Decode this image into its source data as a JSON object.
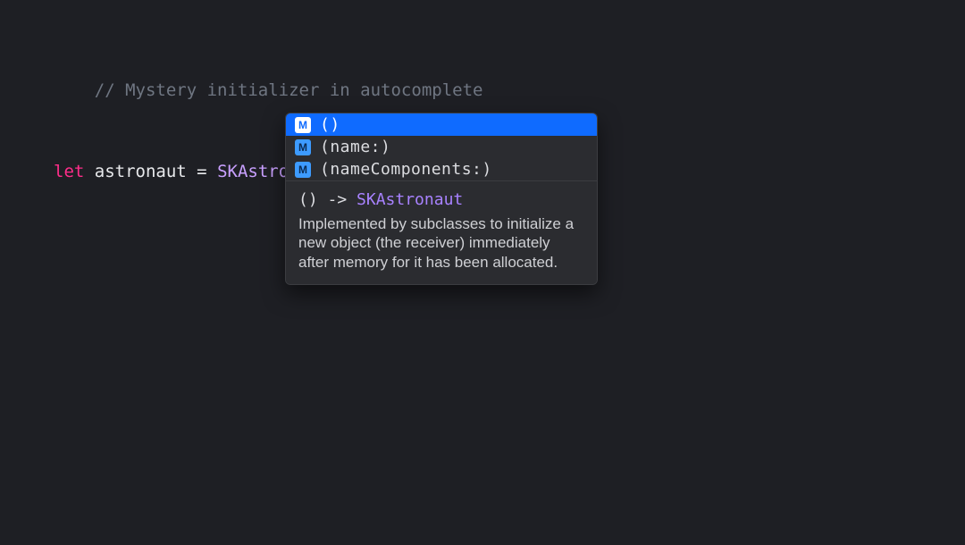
{
  "code": {
    "comment": "// Mystery initializer in autocomplete",
    "keyword_let": "let",
    "var_name": " astronaut ",
    "equals": "= ",
    "type_name": "SKAstronaut",
    "paren": "("
  },
  "autocomplete": {
    "items": [
      {
        "icon": "M",
        "label": "()"
      },
      {
        "icon": "M",
        "label": "(name:)"
      },
      {
        "icon": "M",
        "label": "(nameComponents:)"
      }
    ],
    "signature_prefix": "() -> ",
    "signature_return_type": "SKAstronaut",
    "description": "Implemented by subclasses to initialize a new object (the receiver) immediately after memory for it has been allocated."
  }
}
